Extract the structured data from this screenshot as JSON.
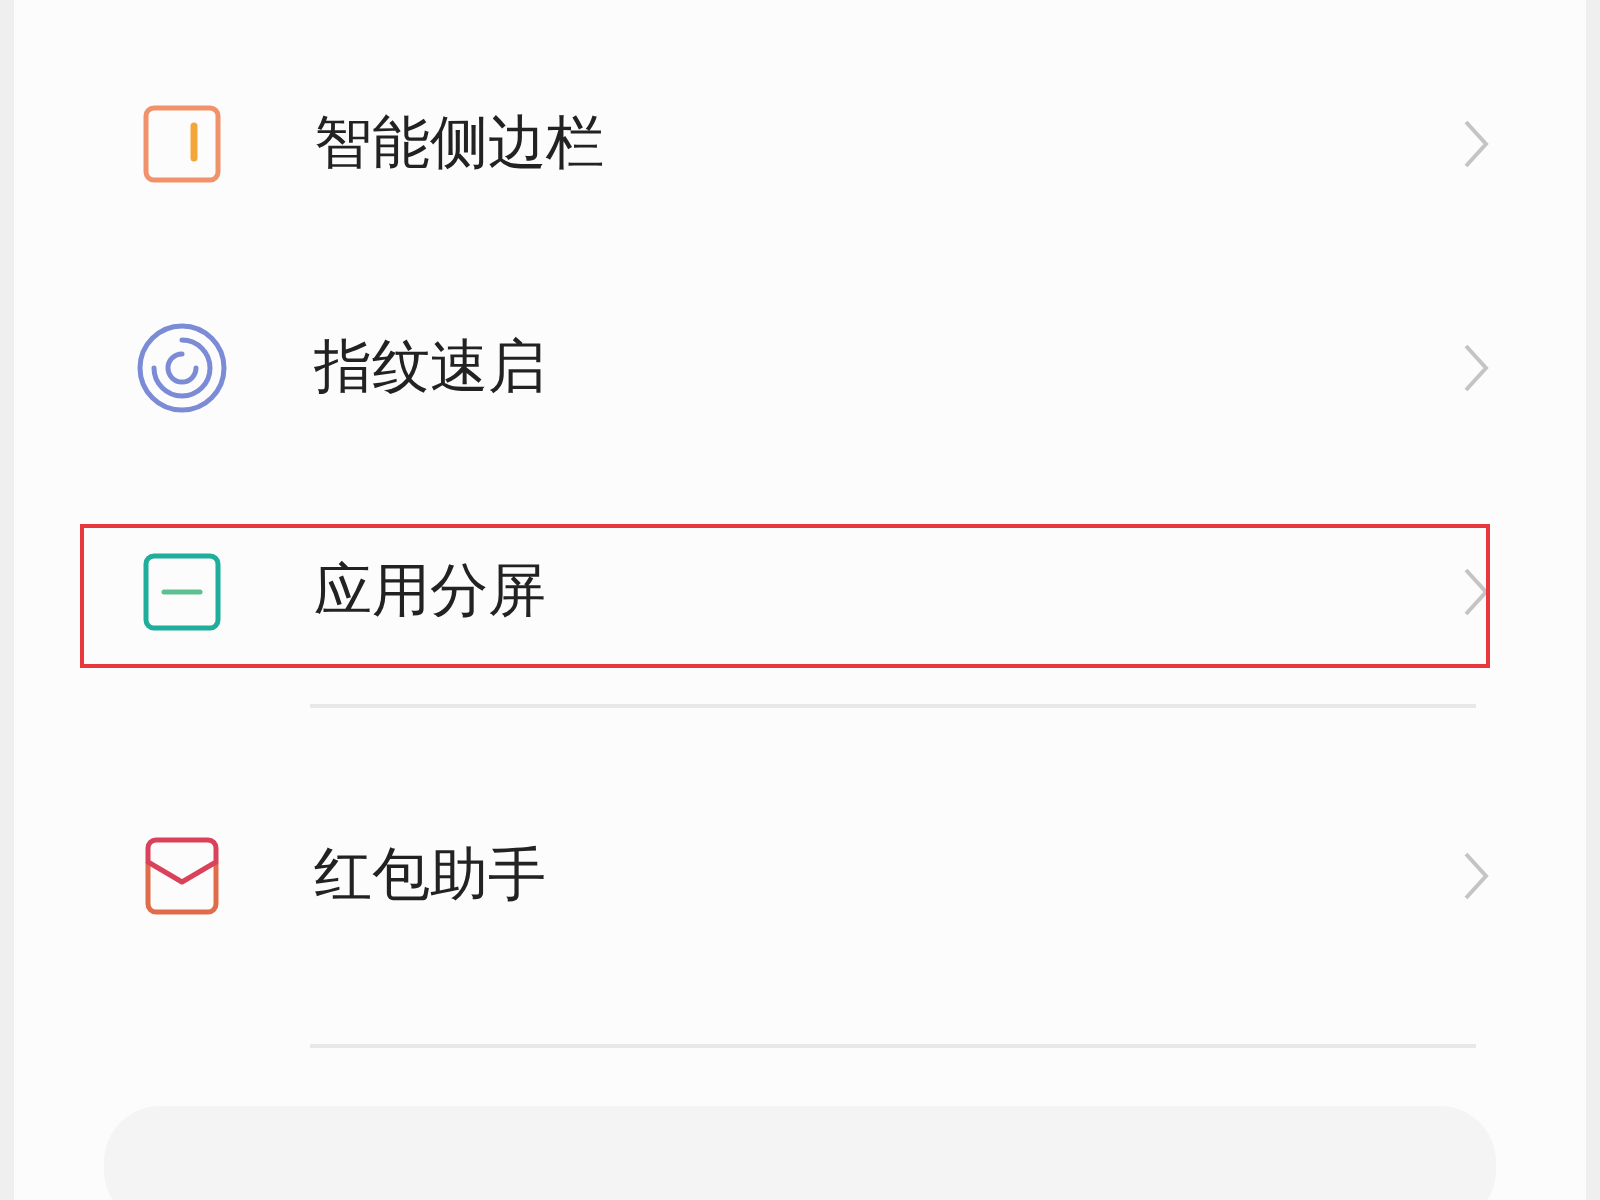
{
  "items": [
    {
      "kind": "sidebar",
      "label": "智能侧边栏",
      "highlighted": false,
      "divider_after": false
    },
    {
      "kind": "fingerprint",
      "label": "指纹速启",
      "highlighted": false,
      "divider_after": false
    },
    {
      "kind": "split",
      "label": "应用分屏",
      "highlighted": true,
      "divider_after": true
    },
    {
      "kind": "envelope",
      "label": "红包助手",
      "highlighted": false,
      "divider_after": true
    }
  ]
}
